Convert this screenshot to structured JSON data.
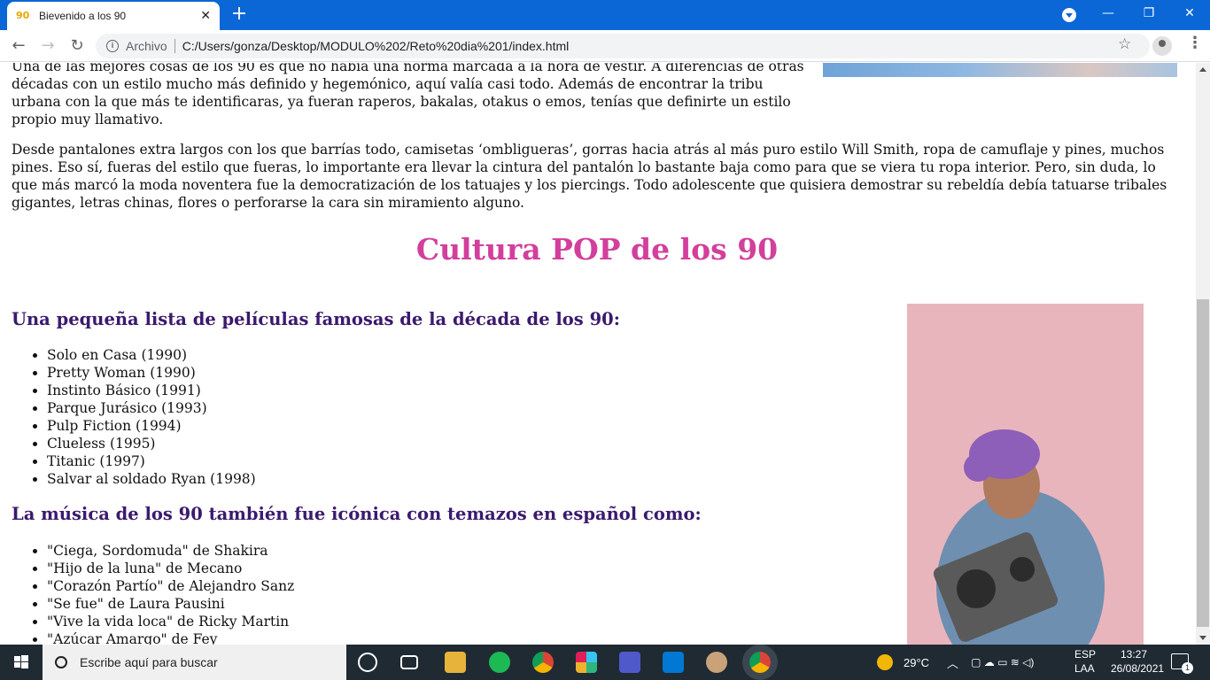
{
  "browser": {
    "tab_title": "Bievenido a los 90",
    "tab_favicon": "90",
    "address_scheme": "Archivo",
    "address_url": "C:/Users/gonza/Desktop/MODULO%202/Reto%20dia%201/index.html"
  },
  "page": {
    "paragraph1": "Una de las mejores cosas de los 90 es que no había una norma marcada a la hora de vestir. A diferencias de otras décadas con un estilo mucho más definido y hegemónico, aquí valía casi todo. Además de encontrar la tribu urbana con la que más te identificaras, ya fueran raperos, bakalas, otakus o emos, tenías que definirte un estilo propio muy llamativo.",
    "paragraph2": "Desde pantalones extra largos con los que barrías todo, camisetas ‘ombligueras’, gorras hacia atrás al más puro estilo Will Smith, ropa de camuflaje y pines, muchos pines. Eso sí, fueras del estilo que fueras, lo importante era llevar la cintura del pantalón lo bastante baja como para que se viera tu ropa interior. Pero, sin duda, lo que más marcó la moda noventera fue la democratización de los tatuajes y los piercings. Todo adolescente que quisiera demostrar su rebeldía debía tatuarse tribales gigantes, letras chinas, flores o perforarse la cara sin miramiento alguno.",
    "section_title": "Cultura POP de los 90",
    "movies_heading": "Una pequeña lista de películas famosas de la década de los 90:",
    "movies": [
      "Solo en Casa (1990)",
      "Pretty Woman (1990)",
      "Instinto Básico (1991)",
      "Parque Jurásico (1993)",
      "Pulp Fiction (1994)",
      "Clueless (1995)",
      "Titanic (1997)",
      "Salvar al soldado Ryan (1998)"
    ],
    "music_heading": "La música de los 90 también fue icónica con temazos en español como:",
    "songs": [
      "\"Ciega, Sordomuda\" de Shakira",
      "\"Hijo de la luna\" de Mecano",
      "\"Corazón Partío\" de Alejandro Sanz",
      "\"Se fue\" de Laura Pausini",
      "\"Vive la vida loca\" de Ricky Martin",
      "\"Azúcar Amargo\" de Fey"
    ]
  },
  "taskbar": {
    "search_placeholder": "Escribe aquí para buscar",
    "weather": "29°C",
    "lang_line1": "ESP",
    "lang_line2": "LAA",
    "time": "13:27",
    "date": "26/08/2021",
    "notification_count": "1"
  },
  "colors": {
    "titlebar": "#0b66d6",
    "section_title": "#d23f9c",
    "headings": "#3b1a6e",
    "photo_bg": "#e9b5bd"
  }
}
